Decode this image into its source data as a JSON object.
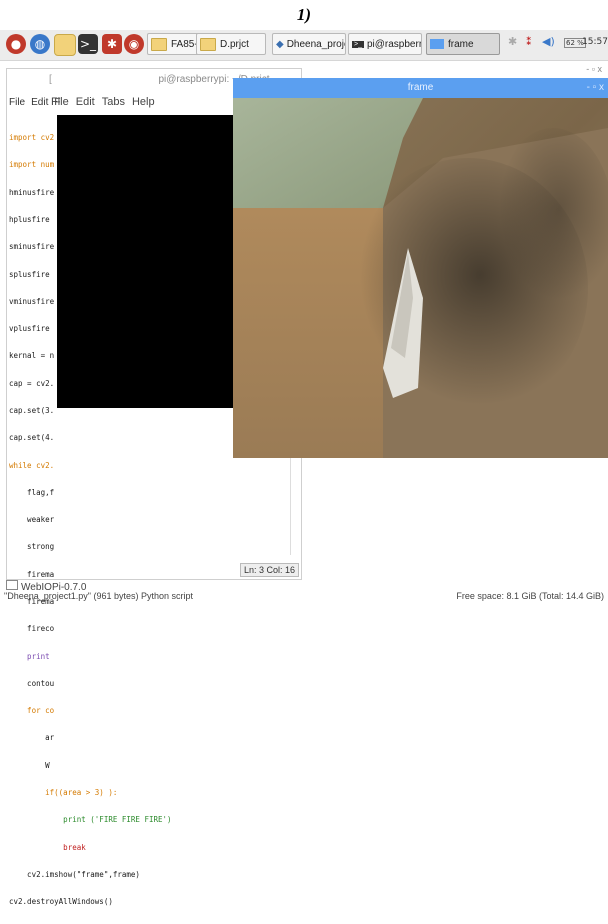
{
  "caption": "1)",
  "taskbar": {
    "tasks": [
      {
        "label": "FA85-651F"
      },
      {
        "label": "D.prjct"
      },
      {
        "label": "Dheena_project-..."
      },
      {
        "label": "pi@raspberrypi: ..."
      },
      {
        "label": "frame"
      }
    ],
    "volume_pct": "62 %",
    "clock": "15:57"
  },
  "terminal": {
    "title": "pi@raspberrypi: ~/D.prjct",
    "title_glyph": "[",
    "menu_outer": [
      "File",
      "Edit",
      "F"
    ],
    "menu_inner": [
      "File",
      "Edit",
      "Tabs",
      "Help"
    ],
    "code_lines": [
      "import cv2",
      "import num",
      "hminusfire",
      "hplusfire ",
      "sminusfire",
      "splusfire ",
      "vminusfire",
      "vplusfire ",
      "kernal = n",
      "cap = cv2.",
      "cap.set(3.",
      "cap.set(4.",
      "while cv2.",
      "    flag,f",
      "    weaker",
      "    strong",
      "    firema",
      "    firema",
      "    fireco",
      "    print ",
      "    contou",
      "    for co",
      "        ar",
      "        W "
    ],
    "tail_lines": [
      "        if((area > 3) ):",
      "            print ('FIRE FIRE FIRE')",
      "            break",
      "    cv2.imshow(\"frame\",frame)",
      "cv2.destroyAllWindows()"
    ],
    "cursor_pos": "Ln: 3 Col: 16"
  },
  "frame_window": {
    "title": "frame",
    "controls": "-  ▫  x"
  },
  "file_manager": {
    "row": "WebIOPi-0.7.0"
  },
  "statusbar": {
    "left": "\"Dheena_project1.py\" (961 bytes) Python script",
    "right": "Free space: 8.1 GiB (Total: 14.4 GiB)"
  },
  "corner_controls": "-  ▫  x"
}
